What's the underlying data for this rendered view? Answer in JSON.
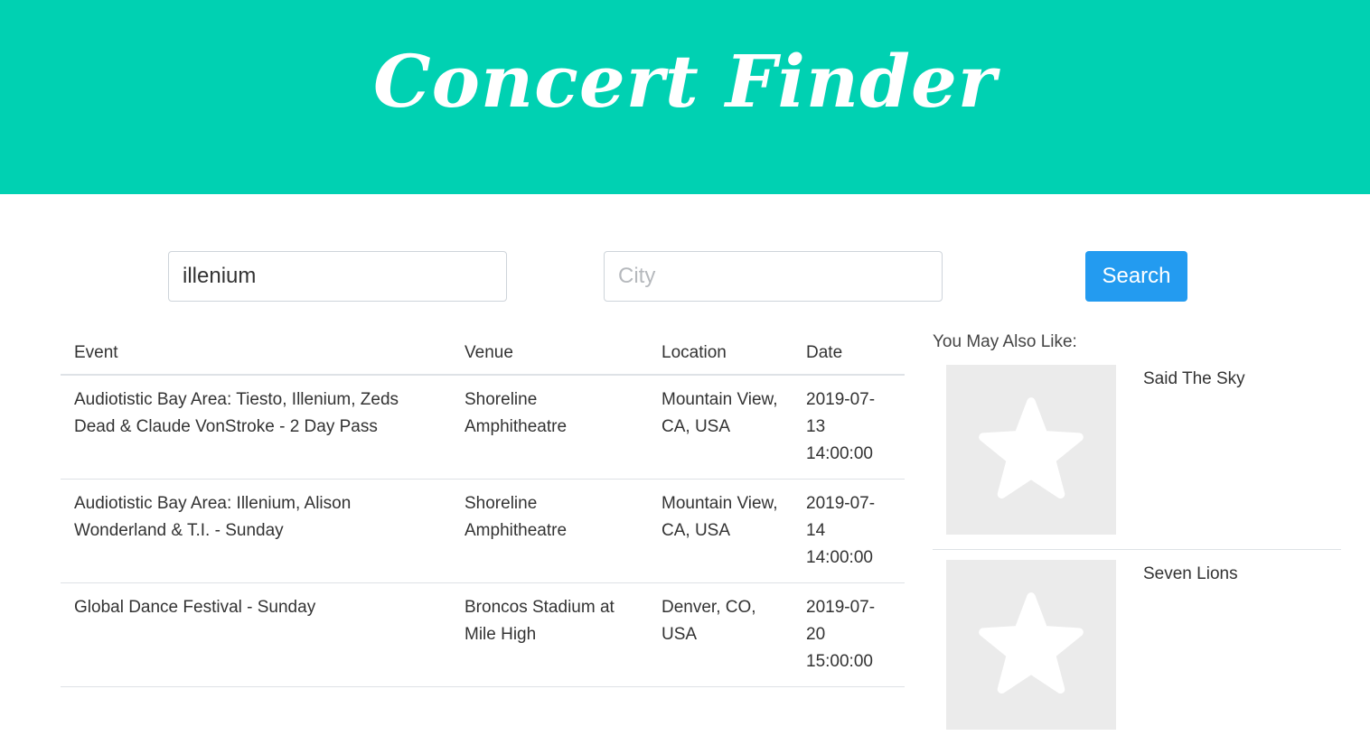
{
  "header": {
    "title": "Concert Finder",
    "bg_color": "#00d1b2"
  },
  "search": {
    "artist_value": "illenium",
    "artist_placeholder": "",
    "city_value": "",
    "city_placeholder": "City",
    "button_label": "Search",
    "button_color": "#239bf0"
  },
  "table": {
    "headers": [
      "Event",
      "Venue",
      "Location",
      "Date"
    ],
    "rows": [
      {
        "event": "Audiotistic Bay Area: Tiesto, Illenium, Zeds Dead & Claude VonStroke - 2 Day Pass",
        "venue": "Shoreline Amphitheatre",
        "location": "Mountain View, CA, USA",
        "date": "2019-07-13 14:00:00"
      },
      {
        "event": "Audiotistic Bay Area: Illenium, Alison Wonderland & T.I. - Sunday",
        "venue": "Shoreline Amphitheatre",
        "location": "Mountain View, CA, USA",
        "date": "2019-07-14 14:00:00"
      },
      {
        "event": "Global Dance Festival - Sunday",
        "venue": "Broncos Stadium at Mile High",
        "location": "Denver, CO, USA",
        "date": "2019-07-20 15:00:00"
      }
    ]
  },
  "sidebar": {
    "title": "You May Also Like:",
    "items": [
      {
        "name": "Said The Sky",
        "icon": "star-placeholder-icon"
      },
      {
        "name": "Seven Lions",
        "icon": "star-placeholder-icon"
      }
    ]
  }
}
